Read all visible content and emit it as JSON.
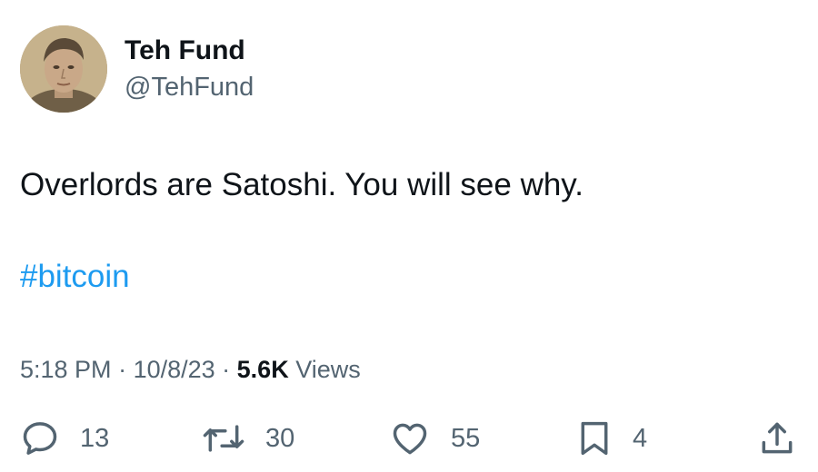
{
  "author": {
    "display_name": "Teh Fund",
    "handle": "@TehFund",
    "avatar_icon": "avatar-photo"
  },
  "tweet": {
    "text": "Overlords are Satoshi. You will see why.",
    "hashtag": "#bitcoin"
  },
  "meta": {
    "time": "5:18 PM",
    "sep1": " · ",
    "date": "10/8/23",
    "sep2": " · ",
    "views_count": "5.6K",
    "views_label": " Views"
  },
  "actions": {
    "reply": {
      "icon": "reply-icon",
      "count": "13"
    },
    "retweet": {
      "icon": "retweet-icon",
      "count": "30"
    },
    "like": {
      "icon": "heart-icon",
      "count": "55"
    },
    "bookmark": {
      "icon": "bookmark-icon",
      "count": "4"
    },
    "share": {
      "icon": "share-icon"
    }
  },
  "colors": {
    "text": "#0f1419",
    "secondary": "#536471",
    "link": "#1d9bf0"
  }
}
